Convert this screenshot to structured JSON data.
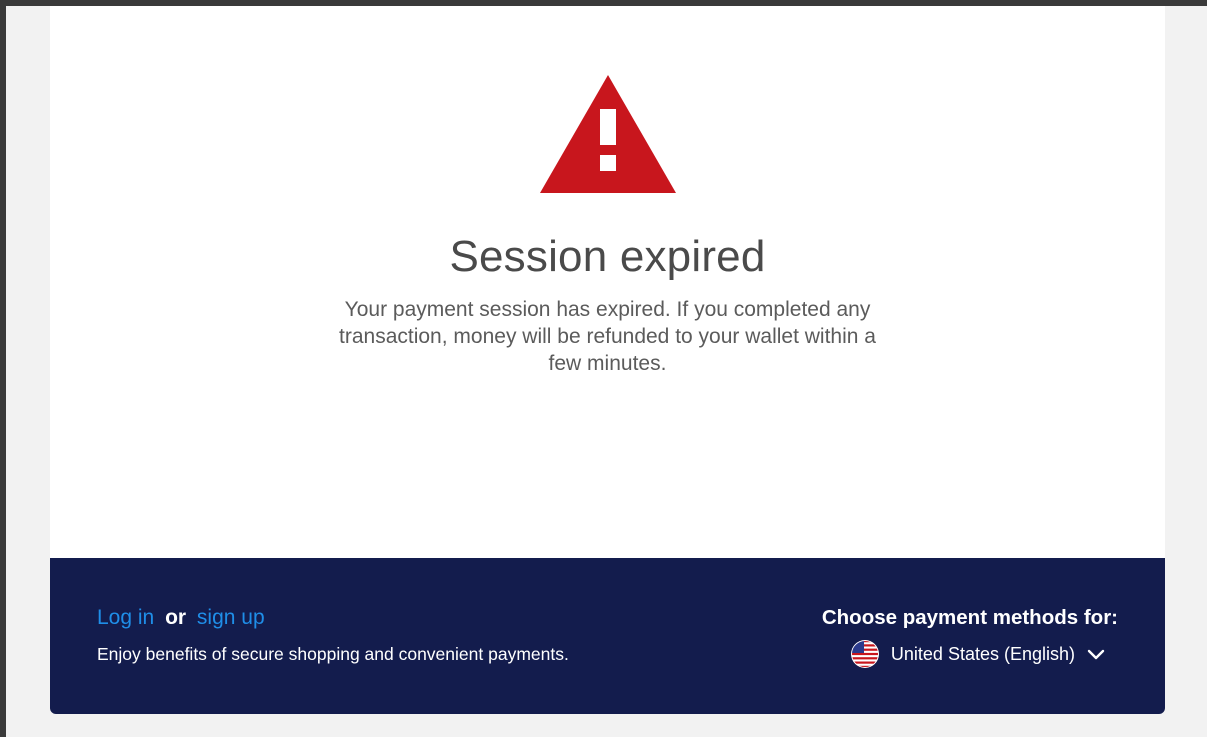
{
  "session": {
    "title": "Session expired",
    "message": "Your payment session has expired. If you completed any transaction, money will be refunded to your wallet within a few minutes.",
    "icon": "warning-triangle-icon",
    "accent_color": "#c8161d"
  },
  "footer": {
    "login_label": "Log in",
    "or_label": "or",
    "signup_label": "sign up",
    "benefits_text": "Enjoy benefits of secure shopping and convenient payments.",
    "choose_label": "Choose payment methods for:",
    "country_value": "United States (English)",
    "flag_icon": "us-flag-icon",
    "background_color": "#131c4d",
    "link_color": "#1f8ee8"
  }
}
